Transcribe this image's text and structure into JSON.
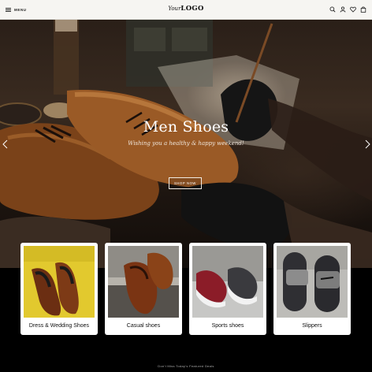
{
  "header": {
    "menu_label": "MENU",
    "logo_prefix": "Your",
    "logo_main": "LOGO",
    "icons": [
      "search-icon",
      "user-icon",
      "heart-icon",
      "bag-icon"
    ]
  },
  "hero": {
    "title": "Men Shoes",
    "subtitle": "Wishing you a healthy & happy weekend!",
    "button_label": "SHOP NOW",
    "prev_icon": "chevron-left-icon",
    "next_icon": "chevron-right-icon"
  },
  "categories": [
    {
      "label": "Dress & Wedding Shoes"
    },
    {
      "label": "Casual shoes"
    },
    {
      "label": "Sports shoes"
    },
    {
      "label": "Slippers"
    }
  ],
  "footer": {
    "note": "Don't Miss Today's Featured Deals"
  },
  "colors": {
    "header_bg": "#f6f5f2",
    "hero_leather": "#8c5023",
    "page_bg": "#000000"
  }
}
